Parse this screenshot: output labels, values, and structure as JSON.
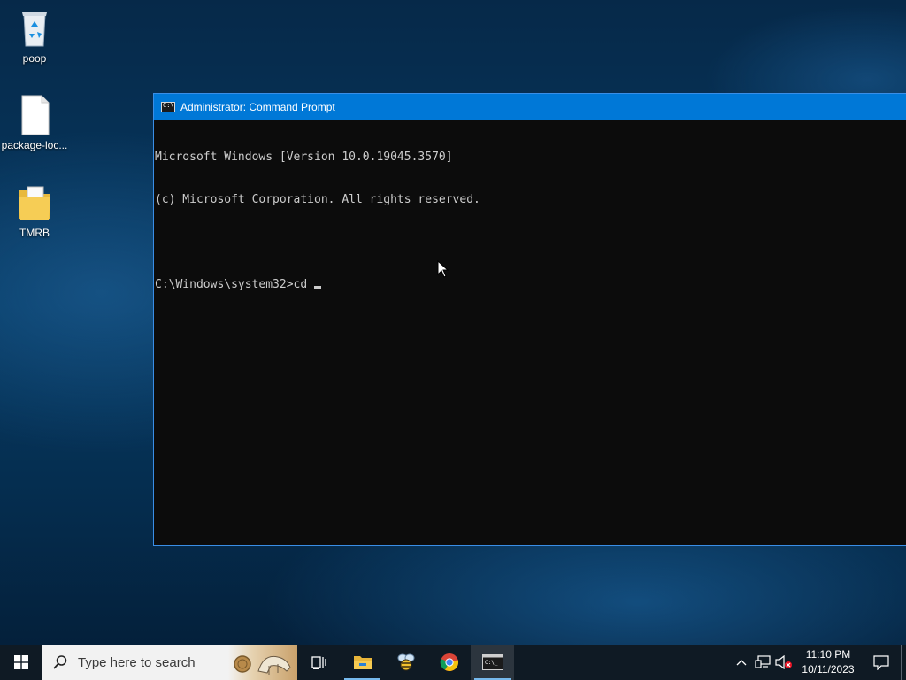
{
  "desktop": {
    "icons": [
      {
        "label": "poop",
        "icon": "recycle-bin-icon"
      },
      {
        "label": "package-loc...",
        "icon": "file-icon"
      },
      {
        "label": "TMRB",
        "icon": "folder-icon"
      }
    ]
  },
  "cmd_window": {
    "title": "Administrator: Command Prompt",
    "lines": [
      "Microsoft Windows [Version 10.0.19045.3570]",
      "(c) Microsoft Corporation. All rights reserved.",
      "",
      "C:\\Windows\\system32>cd "
    ]
  },
  "taskbar": {
    "search_placeholder": "Type here to search",
    "apps": [
      {
        "name": "Task View",
        "icon": "task-view-icon"
      },
      {
        "name": "File Explorer",
        "icon": "file-explorer-icon"
      },
      {
        "name": "Bee app",
        "icon": "bee-icon"
      },
      {
        "name": "Google Chrome",
        "icon": "chrome-icon"
      },
      {
        "name": "Command Prompt",
        "icon": "cmd-icon"
      }
    ],
    "clock": {
      "time": "11:10 PM",
      "date": "10/11/2023"
    }
  },
  "colors": {
    "titlebar": "#0078d7",
    "console_bg": "#0c0c0c",
    "console_text": "#cccccc",
    "taskbar": "#0f1a24"
  }
}
